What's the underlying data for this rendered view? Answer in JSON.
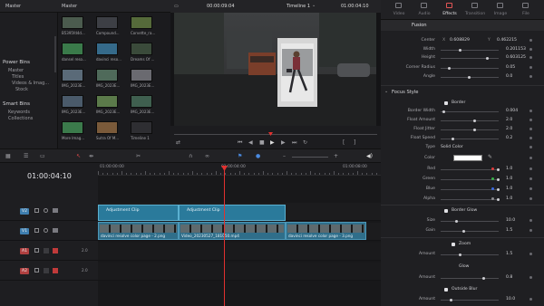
{
  "media_pool": {
    "title": "Master",
    "thumbs": [
      {
        "label": "B5395fd4d...",
        "color": "#4b5b4e"
      },
      {
        "label": "Compound...",
        "color": "#3d3f45"
      },
      {
        "label": "Corvette_ra...",
        "color": "#556a3a"
      },
      {
        "label": "dansel reso...",
        "color": "#3a7a4a"
      },
      {
        "label": "davinci reso...",
        "color": "#356a8a"
      },
      {
        "label": "Dreams Of ...",
        "color": "#3a4a3a"
      },
      {
        "label": "IMG_2023E...",
        "color": "#5a6a78"
      },
      {
        "label": "IMG_2023E...",
        "color": "#4f6a5a"
      },
      {
        "label": "IMG_2023E...",
        "color": "#6a6a70"
      },
      {
        "label": "IMG_2023E...",
        "color": "#4a5a6a"
      },
      {
        "label": "IMG_2023E...",
        "color": "#5b7a4a"
      },
      {
        "label": "IMG_2023E...",
        "color": "#3f5f4f"
      },
      {
        "label": "More Imag...",
        "color": "#3b7a4b"
      },
      {
        "label": "Sutra Of M...",
        "color": "#7a5a3a"
      },
      {
        "label": "Timeline 1",
        "color": "#2e2e32"
      }
    ]
  },
  "sidebar": {
    "power_bins": "Power Bins",
    "power_items": [
      "Master",
      "Titles",
      "Videos & Imag...",
      "Stock"
    ],
    "smart_bins": "Smart Bins",
    "smart_items": [
      "Keywords",
      "Collections"
    ]
  },
  "viewer": {
    "timecode": "00:00:09:04",
    "timeline_name": "Timeline 1",
    "right_timecode": "01:00:04:10"
  },
  "inspector": {
    "tabs": [
      "Video",
      "Audio",
      "Effects",
      "Transition",
      "Image",
      "File"
    ],
    "active_tab": "Effects",
    "subtabs": [
      "Fusion"
    ],
    "transform": [
      {
        "label": "Center",
        "x_label": "X",
        "x": "0.608829",
        "y_label": "Y",
        "y": "0.462215"
      },
      {
        "label": "Width",
        "value": "0.201153"
      },
      {
        "label": "Height",
        "value": "0.603125"
      },
      {
        "label": "Corner Radius",
        "value": "0.05"
      },
      {
        "label": "Angle",
        "value": "0.0"
      }
    ],
    "focus_style_title": "Focus Style",
    "border_label": "Border",
    "focus_rows": [
      {
        "label": "Border Width",
        "value": "0.004"
      },
      {
        "label": "Float Amount",
        "value": "2.0"
      },
      {
        "label": "Float Jitter",
        "value": "2.0"
      },
      {
        "label": "Float Speed",
        "value": "0.2"
      }
    ],
    "type_label": "Type",
    "type_value": "Solid Color",
    "color_label": "Color",
    "rgba": [
      {
        "label": "Red",
        "value": "1.0",
        "dot": "#e03a3a"
      },
      {
        "label": "Green",
        "value": "1.0",
        "dot": "#3ab04a"
      },
      {
        "label": "Blue",
        "value": "1.0",
        "dot": "#3a6ae0"
      },
      {
        "label": "Alpha",
        "value": "1.0",
        "dot": "#8a8a8e"
      }
    ],
    "border_glow_label": "Border Glow",
    "glow_rows": [
      {
        "label": "Size",
        "value": "10.0"
      },
      {
        "label": "Gain",
        "value": "1.5"
      }
    ],
    "zoom_label": "Zoom",
    "zoom_amount_label": "Amount",
    "zoom_amount": "1.5",
    "glow_label": "Glow",
    "glow_amount_label": "Amount",
    "glow_amount": "0.8",
    "outside_blur_label": "Outside Blur",
    "blur_amount_label": "Amount",
    "blur_amount": "10.0"
  },
  "timeline": {
    "timecode": "01:00:04:10",
    "ruler": [
      "01:00:00:00",
      "01:00:04:00",
      "01:00:08:00"
    ],
    "tracks": [
      {
        "id": "V2",
        "color": "#3f7fb0"
      },
      {
        "id": "V1",
        "color": "#3f7fb0"
      },
      {
        "id": "A1",
        "color": "#b04040"
      },
      {
        "id": "A2",
        "color": "#b04040"
      }
    ],
    "audio_levels": [
      "2.0",
      "2.0"
    ],
    "adjustment_clips": [
      "Adjustment Clip",
      "Adjustment Clip"
    ],
    "video_clips": [
      "davinci resolve color page - 2.png",
      "Video_20230527_181050.mp4",
      "davinci resolve color page - 3.png"
    ]
  }
}
